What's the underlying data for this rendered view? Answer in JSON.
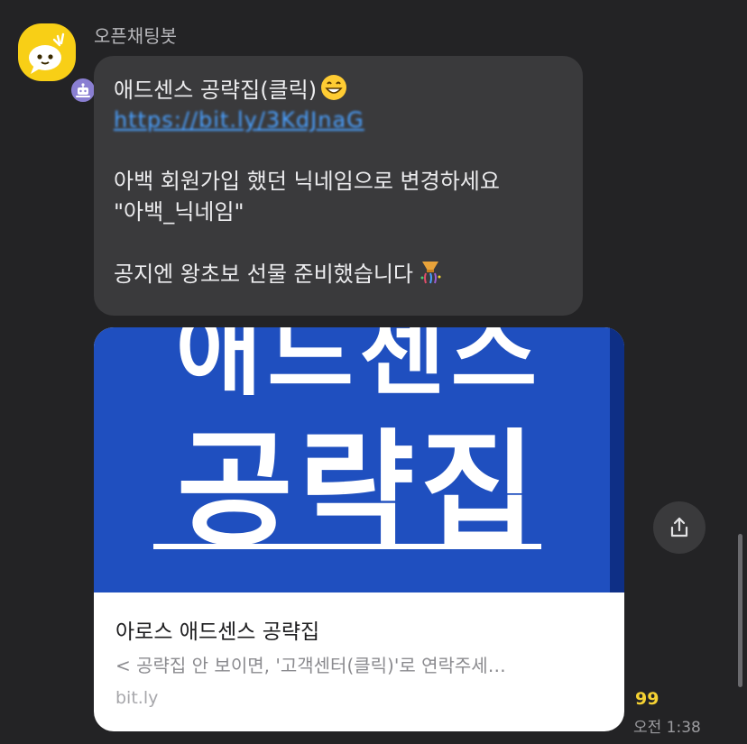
{
  "sender": {
    "name": "오픈채팅봇",
    "avatar_icon": "kakao-openchat-bot-icon",
    "badge_icon": "bot-badge-icon"
  },
  "message": {
    "line1": "애드센스 공략집(클릭)",
    "line1_emoji": "😁",
    "link": "https://bit.ly/3KdJnaG",
    "line3": "아백 회원가입 했던 닉네임으로 변경하세요",
    "line4": "\"아백_닉네임\"",
    "line6": "공지엔 왕초보 선물 준비했습니다",
    "line6_emoji": "🎊"
  },
  "link_card": {
    "image_text_top": "애드센스",
    "image_text_main": "공략집",
    "title": "아로스 애드센스 공략집",
    "description": "< 공략집 안 보이면, '고객센터(클릭)'로 연락주세…",
    "domain": "bit.ly"
  },
  "share_button": {
    "icon": "share-icon"
  },
  "meta": {
    "read_count": "99",
    "time": "오전 1:38"
  },
  "colors": {
    "background": "#232325",
    "bubble": "#3a3a3c",
    "accent": "#f5d233",
    "card_image": "#1f4fbf"
  }
}
